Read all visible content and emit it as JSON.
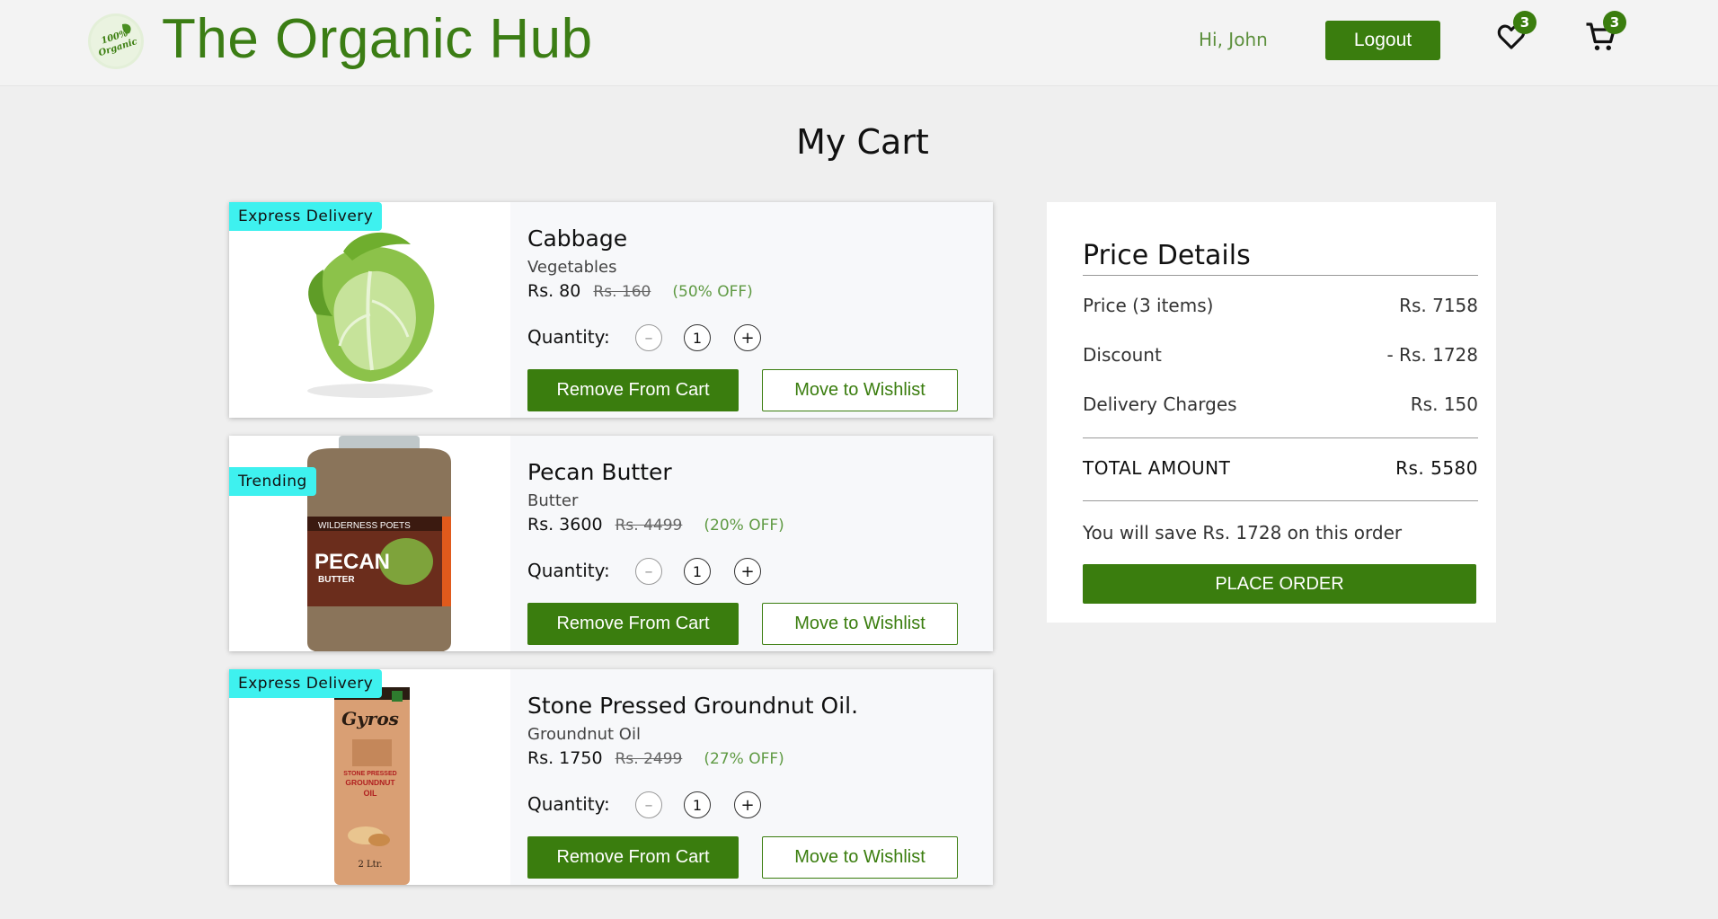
{
  "header": {
    "brand": "The Organic Hub",
    "logo_text": "100% Organic",
    "greeting": "Hi, John",
    "logout_label": "Logout",
    "wishlist_count": "3",
    "cart_count": "3"
  },
  "page_title": "My Cart",
  "cart": {
    "quantity_label": "Quantity:",
    "remove_label": "Remove From Cart",
    "wishlist_label": "Move to Wishlist",
    "minus_symbol": "–",
    "plus_symbol": "+",
    "items": [
      {
        "tag": "Express Delivery",
        "name": "Cabbage",
        "category": "Vegetables",
        "price": "Rs. 80",
        "original_price": "Rs. 160",
        "discount": "(50% OFF)",
        "quantity": "1"
      },
      {
        "tag": "Trending",
        "name": "Pecan Butter",
        "category": "Butter",
        "price": "Rs. 3600",
        "original_price": "Rs. 4499",
        "discount": "(20% OFF)",
        "quantity": "1",
        "label_brand": "WILDERNESS POETS",
        "label_title": "PECAN",
        "label_sub": "BUTTER"
      },
      {
        "tag": "Express Delivery",
        "name": "Stone Pressed Groundnut Oil.",
        "category": "Groundnut Oil",
        "price": "Rs. 1750",
        "original_price": "Rs. 2499",
        "discount": "(27% OFF)",
        "quantity": "1",
        "label_brand": "Gyros",
        "label_title": "STONE PRESSED GROUNDNUT OIL",
        "label_volume": "2 Ltr."
      }
    ]
  },
  "price_details": {
    "title": "Price Details",
    "price_label": "Price (3 items)",
    "price_value": "Rs. 7158",
    "discount_label": "Discount",
    "discount_value": "- Rs. 1728",
    "delivery_label": "Delivery Charges",
    "delivery_value": "Rs. 150",
    "total_label": "TOTAL AMOUNT",
    "total_value": "Rs. 5580",
    "save_message": "You will save Rs. 1728 on this order",
    "place_order_label": "PLACE ORDER"
  },
  "colors": {
    "brand_green": "#3a7d0e",
    "tag_cyan": "#3ef1ef",
    "discount_green": "#5f9a43"
  },
  "icons": [
    "heart-icon",
    "shopping-cart-icon",
    "minus-icon",
    "plus-icon",
    "organic-logo"
  ]
}
